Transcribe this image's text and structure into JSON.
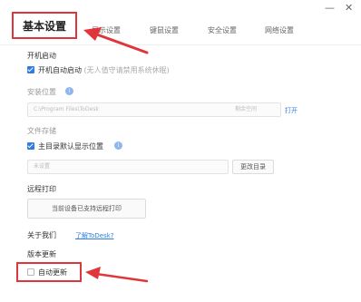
{
  "window": {
    "minimize_glyph": "—",
    "close_glyph": "✕"
  },
  "tabs": [
    {
      "label": "基本设置",
      "active": true
    },
    {
      "label": "显示设置"
    },
    {
      "label": "键鼠设置"
    },
    {
      "label": "安全设置"
    },
    {
      "label": "网络设置"
    }
  ],
  "sections": {
    "startup": {
      "heading": "开机启动",
      "checkbox_label": "开机自动启动",
      "checkbox_hint": "(无人值守请禁用系统休眠)",
      "checked": true
    },
    "install_path": {
      "heading": "安装位置",
      "path_value": "C:\\Program Files\\ToDesk",
      "size_text": "剩余空间",
      "open_label": "打开"
    },
    "file_storage": {
      "heading": "文件存储",
      "checkbox_label": "主目录默认显示位置",
      "checked": true,
      "placeholder": "未设置",
      "change_button": "更改目录"
    },
    "remote_print": {
      "heading": "远程打印",
      "button_label": "当前设备已支持远程打印"
    },
    "about": {
      "heading": "关于我们",
      "link_label": "了解ToDesk?"
    },
    "update": {
      "heading": "版本更新",
      "checkbox_label": "自动更新",
      "checked": false
    }
  },
  "colors": {
    "accent": "#2f7de1",
    "annotation_red": "#e0363b"
  }
}
